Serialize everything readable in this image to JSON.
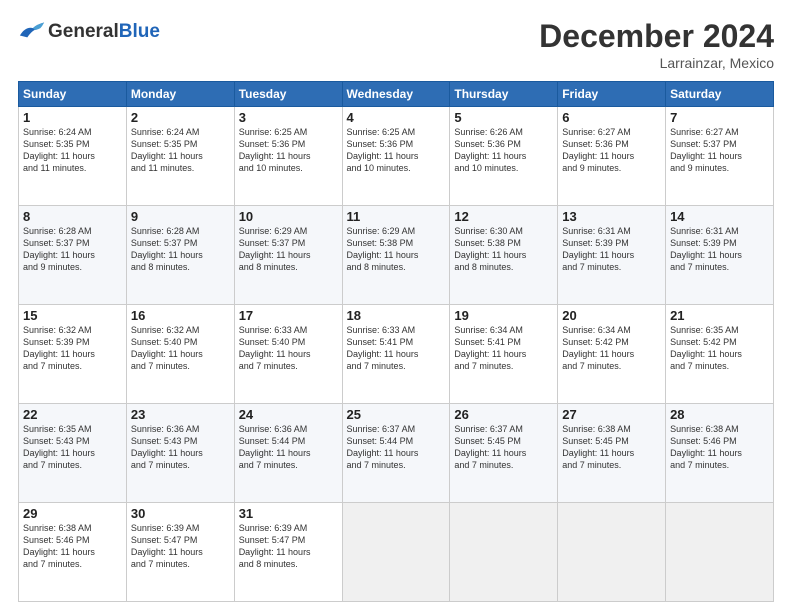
{
  "header": {
    "logo_general": "General",
    "logo_blue": "Blue",
    "month_year": "December 2024",
    "location": "Larrainzar, Mexico"
  },
  "days_of_week": [
    "Sunday",
    "Monday",
    "Tuesday",
    "Wednesday",
    "Thursday",
    "Friday",
    "Saturday"
  ],
  "weeks": [
    [
      {
        "day": "1",
        "lines": [
          "Sunrise: 6:24 AM",
          "Sunset: 5:35 PM",
          "Daylight: 11 hours",
          "and 11 minutes."
        ]
      },
      {
        "day": "2",
        "lines": [
          "Sunrise: 6:24 AM",
          "Sunset: 5:35 PM",
          "Daylight: 11 hours",
          "and 11 minutes."
        ]
      },
      {
        "day": "3",
        "lines": [
          "Sunrise: 6:25 AM",
          "Sunset: 5:36 PM",
          "Daylight: 11 hours",
          "and 10 minutes."
        ]
      },
      {
        "day": "4",
        "lines": [
          "Sunrise: 6:25 AM",
          "Sunset: 5:36 PM",
          "Daylight: 11 hours",
          "and 10 minutes."
        ]
      },
      {
        "day": "5",
        "lines": [
          "Sunrise: 6:26 AM",
          "Sunset: 5:36 PM",
          "Daylight: 11 hours",
          "and 10 minutes."
        ]
      },
      {
        "day": "6",
        "lines": [
          "Sunrise: 6:27 AM",
          "Sunset: 5:36 PM",
          "Daylight: 11 hours",
          "and 9 minutes."
        ]
      },
      {
        "day": "7",
        "lines": [
          "Sunrise: 6:27 AM",
          "Sunset: 5:37 PM",
          "Daylight: 11 hours",
          "and 9 minutes."
        ]
      }
    ],
    [
      {
        "day": "8",
        "lines": [
          "Sunrise: 6:28 AM",
          "Sunset: 5:37 PM",
          "Daylight: 11 hours",
          "and 9 minutes."
        ]
      },
      {
        "day": "9",
        "lines": [
          "Sunrise: 6:28 AM",
          "Sunset: 5:37 PM",
          "Daylight: 11 hours",
          "and 8 minutes."
        ]
      },
      {
        "day": "10",
        "lines": [
          "Sunrise: 6:29 AM",
          "Sunset: 5:37 PM",
          "Daylight: 11 hours",
          "and 8 minutes."
        ]
      },
      {
        "day": "11",
        "lines": [
          "Sunrise: 6:29 AM",
          "Sunset: 5:38 PM",
          "Daylight: 11 hours",
          "and 8 minutes."
        ]
      },
      {
        "day": "12",
        "lines": [
          "Sunrise: 6:30 AM",
          "Sunset: 5:38 PM",
          "Daylight: 11 hours",
          "and 8 minutes."
        ]
      },
      {
        "day": "13",
        "lines": [
          "Sunrise: 6:31 AM",
          "Sunset: 5:39 PM",
          "Daylight: 11 hours",
          "and 7 minutes."
        ]
      },
      {
        "day": "14",
        "lines": [
          "Sunrise: 6:31 AM",
          "Sunset: 5:39 PM",
          "Daylight: 11 hours",
          "and 7 minutes."
        ]
      }
    ],
    [
      {
        "day": "15",
        "lines": [
          "Sunrise: 6:32 AM",
          "Sunset: 5:39 PM",
          "Daylight: 11 hours",
          "and 7 minutes."
        ]
      },
      {
        "day": "16",
        "lines": [
          "Sunrise: 6:32 AM",
          "Sunset: 5:40 PM",
          "Daylight: 11 hours",
          "and 7 minutes."
        ]
      },
      {
        "day": "17",
        "lines": [
          "Sunrise: 6:33 AM",
          "Sunset: 5:40 PM",
          "Daylight: 11 hours",
          "and 7 minutes."
        ]
      },
      {
        "day": "18",
        "lines": [
          "Sunrise: 6:33 AM",
          "Sunset: 5:41 PM",
          "Daylight: 11 hours",
          "and 7 minutes."
        ]
      },
      {
        "day": "19",
        "lines": [
          "Sunrise: 6:34 AM",
          "Sunset: 5:41 PM",
          "Daylight: 11 hours",
          "and 7 minutes."
        ]
      },
      {
        "day": "20",
        "lines": [
          "Sunrise: 6:34 AM",
          "Sunset: 5:42 PM",
          "Daylight: 11 hours",
          "and 7 minutes."
        ]
      },
      {
        "day": "21",
        "lines": [
          "Sunrise: 6:35 AM",
          "Sunset: 5:42 PM",
          "Daylight: 11 hours",
          "and 7 minutes."
        ]
      }
    ],
    [
      {
        "day": "22",
        "lines": [
          "Sunrise: 6:35 AM",
          "Sunset: 5:43 PM",
          "Daylight: 11 hours",
          "and 7 minutes."
        ]
      },
      {
        "day": "23",
        "lines": [
          "Sunrise: 6:36 AM",
          "Sunset: 5:43 PM",
          "Daylight: 11 hours",
          "and 7 minutes."
        ]
      },
      {
        "day": "24",
        "lines": [
          "Sunrise: 6:36 AM",
          "Sunset: 5:44 PM",
          "Daylight: 11 hours",
          "and 7 minutes."
        ]
      },
      {
        "day": "25",
        "lines": [
          "Sunrise: 6:37 AM",
          "Sunset: 5:44 PM",
          "Daylight: 11 hours",
          "and 7 minutes."
        ]
      },
      {
        "day": "26",
        "lines": [
          "Sunrise: 6:37 AM",
          "Sunset: 5:45 PM",
          "Daylight: 11 hours",
          "and 7 minutes."
        ]
      },
      {
        "day": "27",
        "lines": [
          "Sunrise: 6:38 AM",
          "Sunset: 5:45 PM",
          "Daylight: 11 hours",
          "and 7 minutes."
        ]
      },
      {
        "day": "28",
        "lines": [
          "Sunrise: 6:38 AM",
          "Sunset: 5:46 PM",
          "Daylight: 11 hours",
          "and 7 minutes."
        ]
      }
    ],
    [
      {
        "day": "29",
        "lines": [
          "Sunrise: 6:38 AM",
          "Sunset: 5:46 PM",
          "Daylight: 11 hours",
          "and 7 minutes."
        ]
      },
      {
        "day": "30",
        "lines": [
          "Sunrise: 6:39 AM",
          "Sunset: 5:47 PM",
          "Daylight: 11 hours",
          "and 7 minutes."
        ]
      },
      {
        "day": "31",
        "lines": [
          "Sunrise: 6:39 AM",
          "Sunset: 5:47 PM",
          "Daylight: 11 hours",
          "and 8 minutes."
        ]
      },
      null,
      null,
      null,
      null
    ]
  ]
}
